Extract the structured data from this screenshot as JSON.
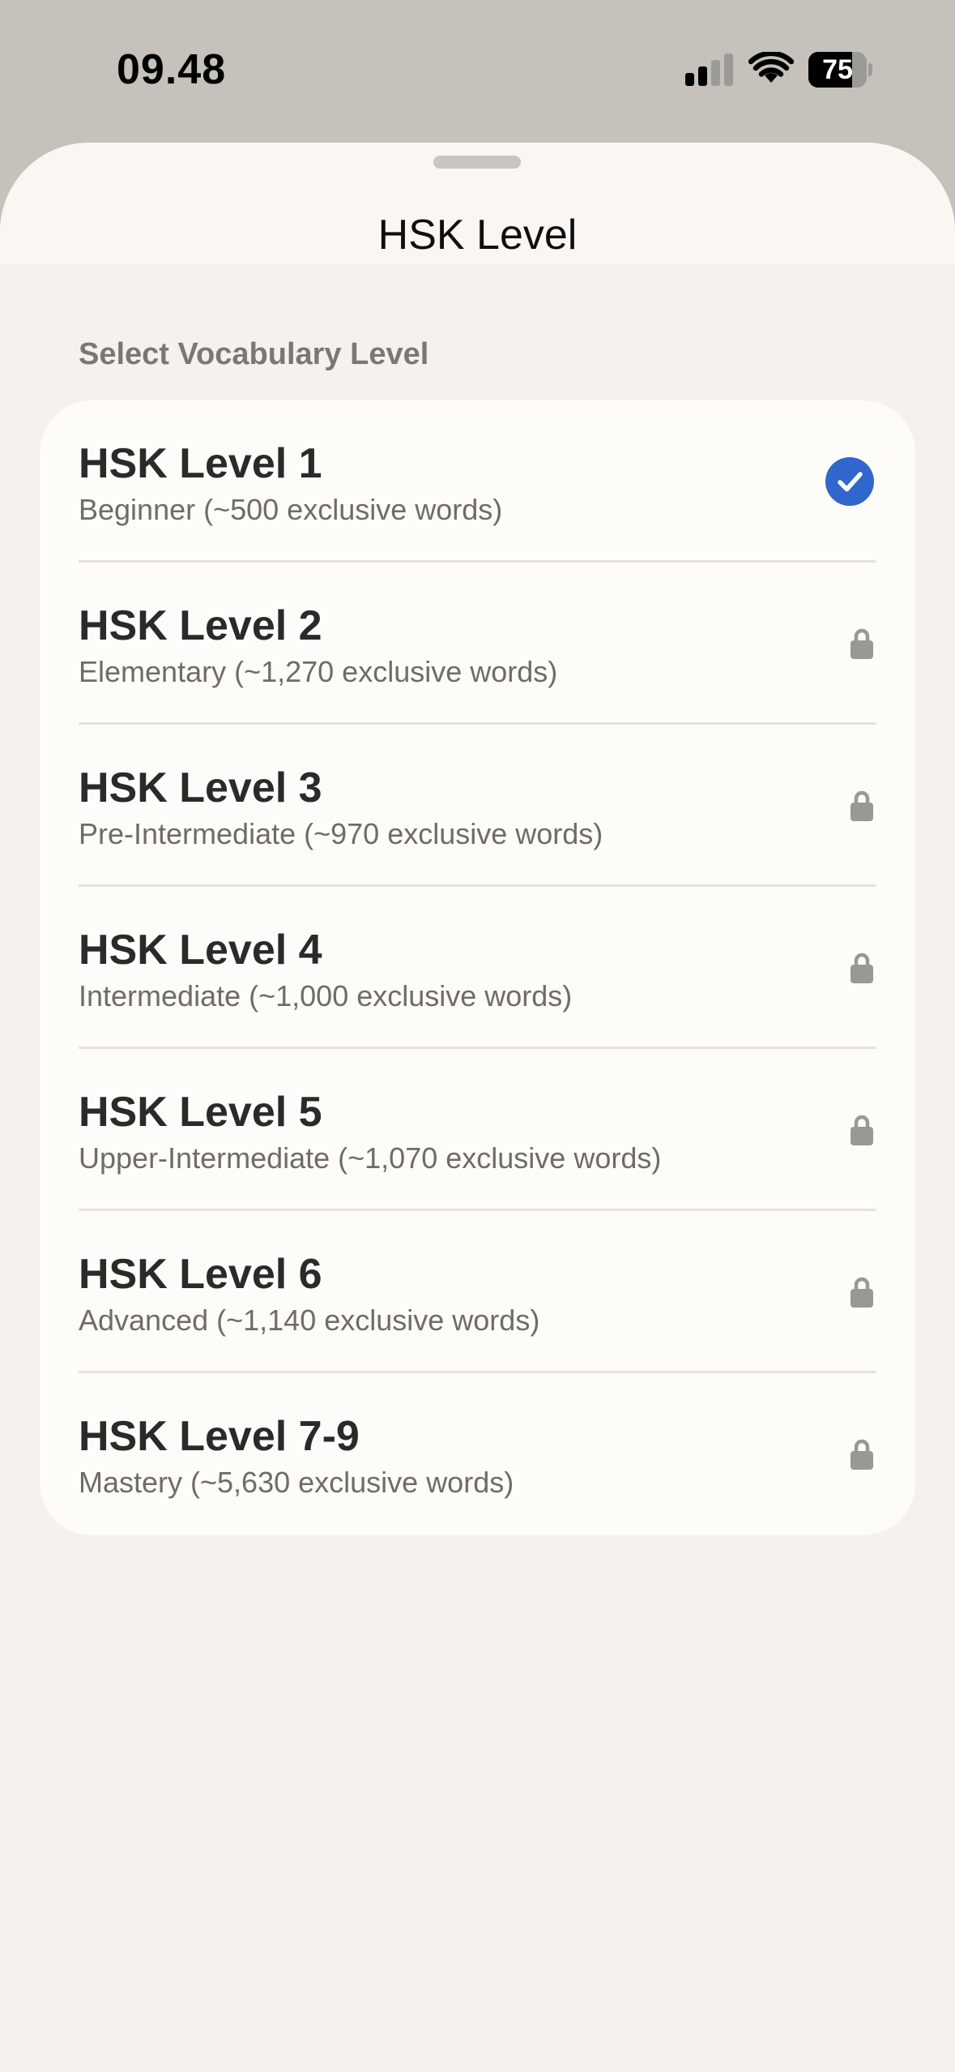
{
  "status_bar": {
    "time": "09.48",
    "battery_level": 75,
    "battery_label": "75"
  },
  "sheet": {
    "title": "HSK Level",
    "section_label": "Select Vocabulary Level"
  },
  "levels": [
    {
      "title": "HSK Level 1",
      "description": "Beginner (~500 exclusive words)",
      "selected": true,
      "locked": false
    },
    {
      "title": "HSK Level 2",
      "description": "Elementary (~1,270 exclusive words)",
      "selected": false,
      "locked": true
    },
    {
      "title": "HSK Level 3",
      "description": "Pre-Intermediate (~970 exclusive words)",
      "selected": false,
      "locked": true
    },
    {
      "title": "HSK Level 4",
      "description": "Intermediate (~1,000 exclusive words)",
      "selected": false,
      "locked": true
    },
    {
      "title": "HSK Level 5",
      "description": "Upper-Intermediate (~1,070 exclusive words)",
      "selected": false,
      "locked": true
    },
    {
      "title": "HSK Level 6",
      "description": "Advanced (~1,140 exclusive words)",
      "selected": false,
      "locked": true
    },
    {
      "title": "HSK Level 7-9",
      "description": "Mastery (~5,630 exclusive words)",
      "selected": false,
      "locked": true
    }
  ],
  "icons": {
    "selected": "checkmark-circle-icon",
    "locked": "lock-icon"
  },
  "colors": {
    "accent": "#3166cc",
    "lock": "#9a9894"
  }
}
